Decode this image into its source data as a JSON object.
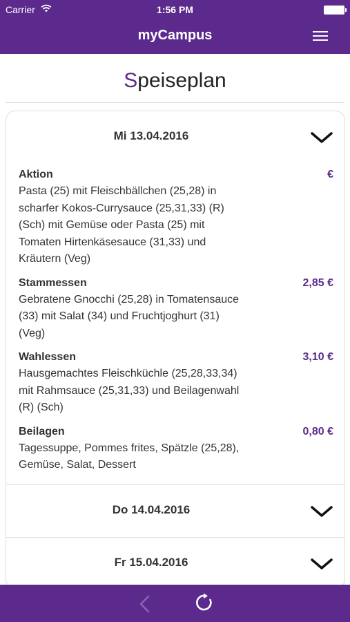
{
  "status": {
    "carrier": "Carrier",
    "time": "1:56 PM"
  },
  "app": {
    "title": "myCampus"
  },
  "page": {
    "title_first": "S",
    "title_rest": "peiseplan"
  },
  "days": [
    {
      "label": "Mi 13.04.2016",
      "meals": [
        {
          "name": "Aktion",
          "price": "€",
          "description": "Pasta (25) mit Fleischbällchen (25,28) in scharfer Kokos-Currysauce (25,31,33) (R) (Sch) mit Gemüse oder Pasta (25) mit Tomaten Hirtenkäsesauce (31,33) und Kräutern (Veg)"
        },
        {
          "name": "Stammessen",
          "price": "2,85 €",
          "description": "Gebratene Gnocchi (25,28) in Tomatensauce (33) mit Salat (34) und Fruchtjoghurt (31) (Veg)"
        },
        {
          "name": "Wahlessen",
          "price": "3,10 €",
          "description": "Hausgemachtes Fleischküchle (25,28,33,34) mit Rahmsauce (25,31,33) und Beilagenwahl (R) (Sch)"
        },
        {
          "name": "Beilagen",
          "price": "0,80 €",
          "description": "Tagessuppe, Pommes frites, Spätzle (25,28), Gemüse, Salat, Dessert"
        }
      ]
    },
    {
      "label": "Do 14.04.2016"
    },
    {
      "label": "Fr 15.04.2016"
    }
  ],
  "colors": {
    "brand": "#5c2a8c",
    "divider": "#dddddd"
  },
  "icons": {
    "menu": "hamburger-menu-icon",
    "back": "chevron-left-icon",
    "refresh": "refresh-icon",
    "expand": "chevron-down-icon"
  }
}
